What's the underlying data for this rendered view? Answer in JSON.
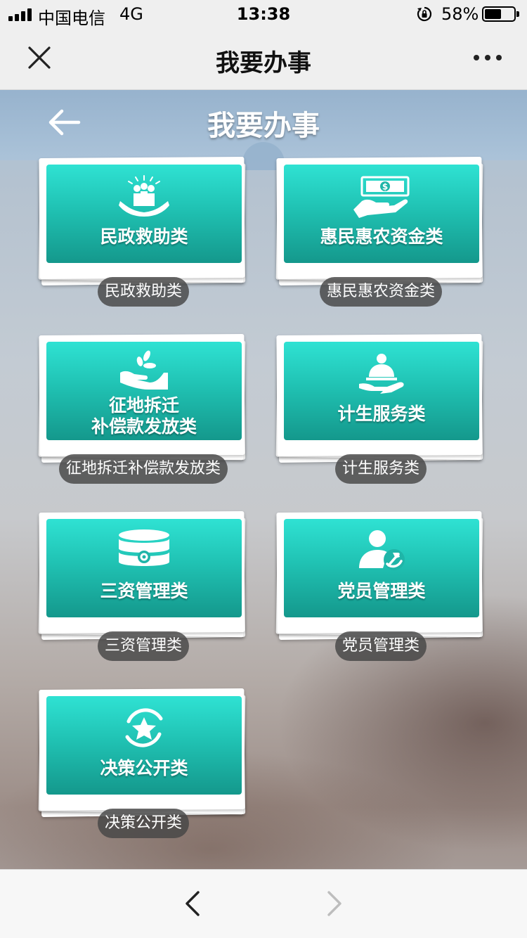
{
  "status_bar": {
    "carrier": "中国电信",
    "network": "4G",
    "time": "13:38",
    "battery_percent": "58%",
    "battery_level": 0.58,
    "icons": [
      "signal-icon",
      "orientation-lock-icon",
      "battery-icon"
    ]
  },
  "nav_bar": {
    "title": "我要办事",
    "icons": [
      "close-icon",
      "more-icon"
    ]
  },
  "page": {
    "title": "我要办事",
    "icons": [
      "back-arrow-icon"
    ]
  },
  "cards": [
    {
      "label_lines": [
        "民政救助类"
      ],
      "caption": "民政救助类",
      "icon": "civil-aid-icon"
    },
    {
      "label_lines": [
        "惠民惠农资金类"
      ],
      "caption": "惠民惠农资金类",
      "icon": "money-hand-icon"
    },
    {
      "label_lines": [
        "征地拆迁",
        "补偿款发放类"
      ],
      "caption": "征地拆迁补偿款发放类",
      "icon": "coins-hand-icon"
    },
    {
      "label_lines": [
        "计生服务类"
      ],
      "caption": "计生服务类",
      "icon": "service-hand-icon"
    },
    {
      "label_lines": [
        "三资管理类"
      ],
      "caption": "三资管理类",
      "icon": "database-gear-icon"
    },
    {
      "label_lines": [
        "党员管理类"
      ],
      "caption": "党员管理类",
      "icon": "party-member-icon"
    },
    {
      "label_lines": [
        "决策公开类"
      ],
      "caption": "决策公开类",
      "icon": "star-circle-icon"
    }
  ],
  "toolbar": {
    "icons": [
      "back-icon",
      "forward-icon"
    ]
  },
  "colors": {
    "tile_top": "#2fe2d3",
    "tile_bottom": "#14988c",
    "caption_bg": "#464646",
    "bar_bg": "#efefef"
  }
}
